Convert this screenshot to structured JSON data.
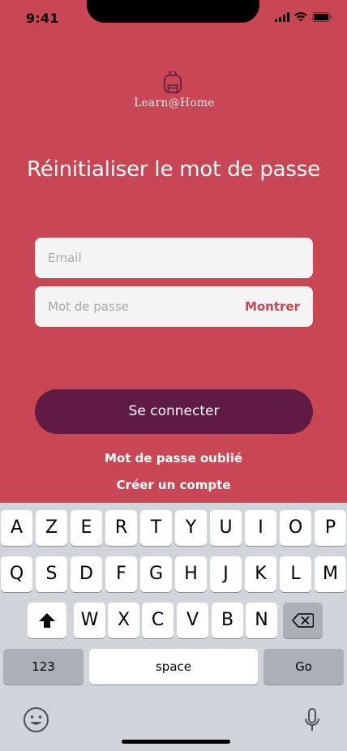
{
  "status_bar": {
    "time": "9:41",
    "icons": [
      "cellular-signal-icon",
      "wifi-icon",
      "battery-icon"
    ]
  },
  "app": {
    "name": "Learn@Home",
    "logo_icon": "backpack-icon"
  },
  "page": {
    "title": "Réinitialiser le mot de passe"
  },
  "form": {
    "email_placeholder": "Email",
    "password_placeholder": "Mot de passe",
    "show_password_label": "Montrer",
    "submit_label": "Se connecter",
    "forgot_password_label": "Mot de passe oublié",
    "create_account_label": "Créer un compte"
  },
  "keyboard": {
    "row1": [
      "A",
      "Z",
      "E",
      "R",
      "T",
      "Y",
      "U",
      "I",
      "O",
      "P"
    ],
    "row2": [
      "Q",
      "S",
      "D",
      "F",
      "G",
      "H",
      "J",
      "K",
      "L",
      "M"
    ],
    "row3": [
      "W",
      "X",
      "C",
      "V",
      "B",
      "N"
    ],
    "numbers_label": "123",
    "space_label": "space",
    "go_label": "Go",
    "icons": [
      "shift-icon",
      "delete-icon",
      "emoji-icon",
      "microphone-icon"
    ]
  },
  "colors": {
    "background": "#c94754",
    "button": "#5f1b44",
    "field": "#f4f4f5",
    "accent_text": "#c94754"
  }
}
